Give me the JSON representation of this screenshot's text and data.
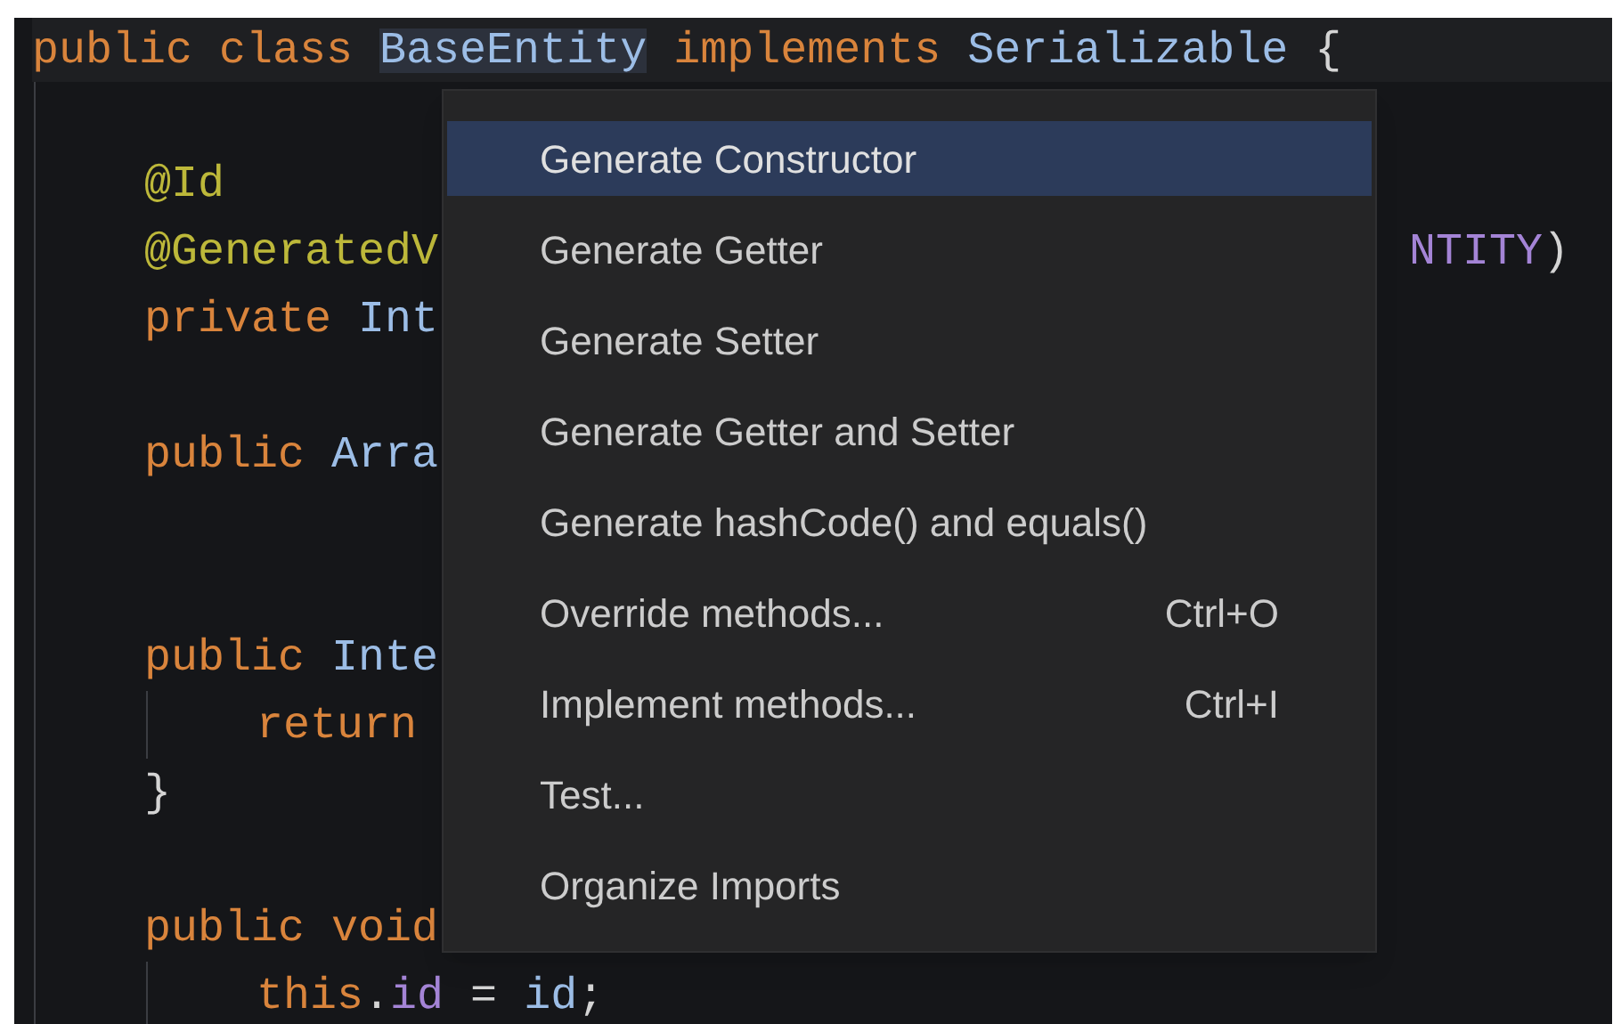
{
  "editor": {
    "lines": [
      {
        "kind": "code",
        "current": true,
        "tokens": [
          {
            "text": "public class ",
            "kind": "keyword"
          },
          {
            "text": "BaseEntity",
            "kind": "type",
            "highlighted": true
          },
          {
            "text": " implements ",
            "kind": "keyword"
          },
          {
            "text": "Serializable",
            "kind": "type"
          },
          {
            "text": " {",
            "kind": "punct"
          }
        ],
        "children": [
          {
            "kind": "blank"
          },
          {
            "kind": "code",
            "tokens": [
              {
                "text": "@Id",
                "kind": "annotation"
              }
            ]
          },
          {
            "kind": "code",
            "tokens": [
              {
                "text": "@GeneratedV",
                "kind": "annotation"
              }
            ],
            "after_menu": [
              {
                "text": "NTITY",
                "kind": "field"
              },
              {
                "text": ")",
                "kind": "punct"
              }
            ]
          },
          {
            "kind": "code",
            "tokens": [
              {
                "text": "private ",
                "kind": "keyword"
              },
              {
                "text": "Int",
                "kind": "type"
              }
            ]
          },
          {
            "kind": "blank"
          },
          {
            "kind": "code",
            "tokens": [
              {
                "text": "public ",
                "kind": "keyword"
              },
              {
                "text": "Arra",
                "kind": "type"
              }
            ]
          },
          {
            "kind": "blank"
          },
          {
            "kind": "blank"
          },
          {
            "kind": "code",
            "tokens": [
              {
                "text": "public ",
                "kind": "keyword"
              },
              {
                "text": "Inte",
                "kind": "type"
              }
            ],
            "children": [
              {
                "kind": "code",
                "tokens": [
                  {
                    "text": "return",
                    "kind": "keyword"
                  }
                ]
              }
            ]
          },
          {
            "kind": "code",
            "tokens": [
              {
                "text": "}",
                "kind": "punct"
              }
            ]
          },
          {
            "kind": "blank"
          },
          {
            "kind": "code",
            "tokens": [
              {
                "text": "public ",
                "kind": "keyword"
              },
              {
                "text": "void",
                "kind": "keyword"
              }
            ],
            "children": [
              {
                "kind": "code",
                "tokens": [
                  {
                    "text": "this",
                    "kind": "keyword"
                  },
                  {
                    "text": ".",
                    "kind": "punct"
                  },
                  {
                    "text": "id",
                    "kind": "field"
                  },
                  {
                    "text": " = ",
                    "kind": "punct"
                  },
                  {
                    "text": "id",
                    "kind": "type"
                  },
                  {
                    "text": ";",
                    "kind": "punct"
                  }
                ]
              }
            ]
          }
        ]
      }
    ]
  },
  "context_menu": {
    "items": [
      {
        "label": "Generate Constructor",
        "selected": true
      },
      {
        "label": "Generate Getter",
        "selected": false
      },
      {
        "label": "Generate Setter",
        "selected": false
      },
      {
        "label": "Generate Getter and Setter",
        "selected": false
      },
      {
        "label": "Generate hashCode() and equals()",
        "selected": false
      },
      {
        "label": "Override methods...",
        "shortcut": "Ctrl+O",
        "selected": false
      },
      {
        "label": "Implement methods...",
        "shortcut": "Ctrl+I",
        "selected": false
      },
      {
        "label": "Test...",
        "selected": false
      },
      {
        "label": "Organize Imports",
        "selected": false
      }
    ]
  }
}
